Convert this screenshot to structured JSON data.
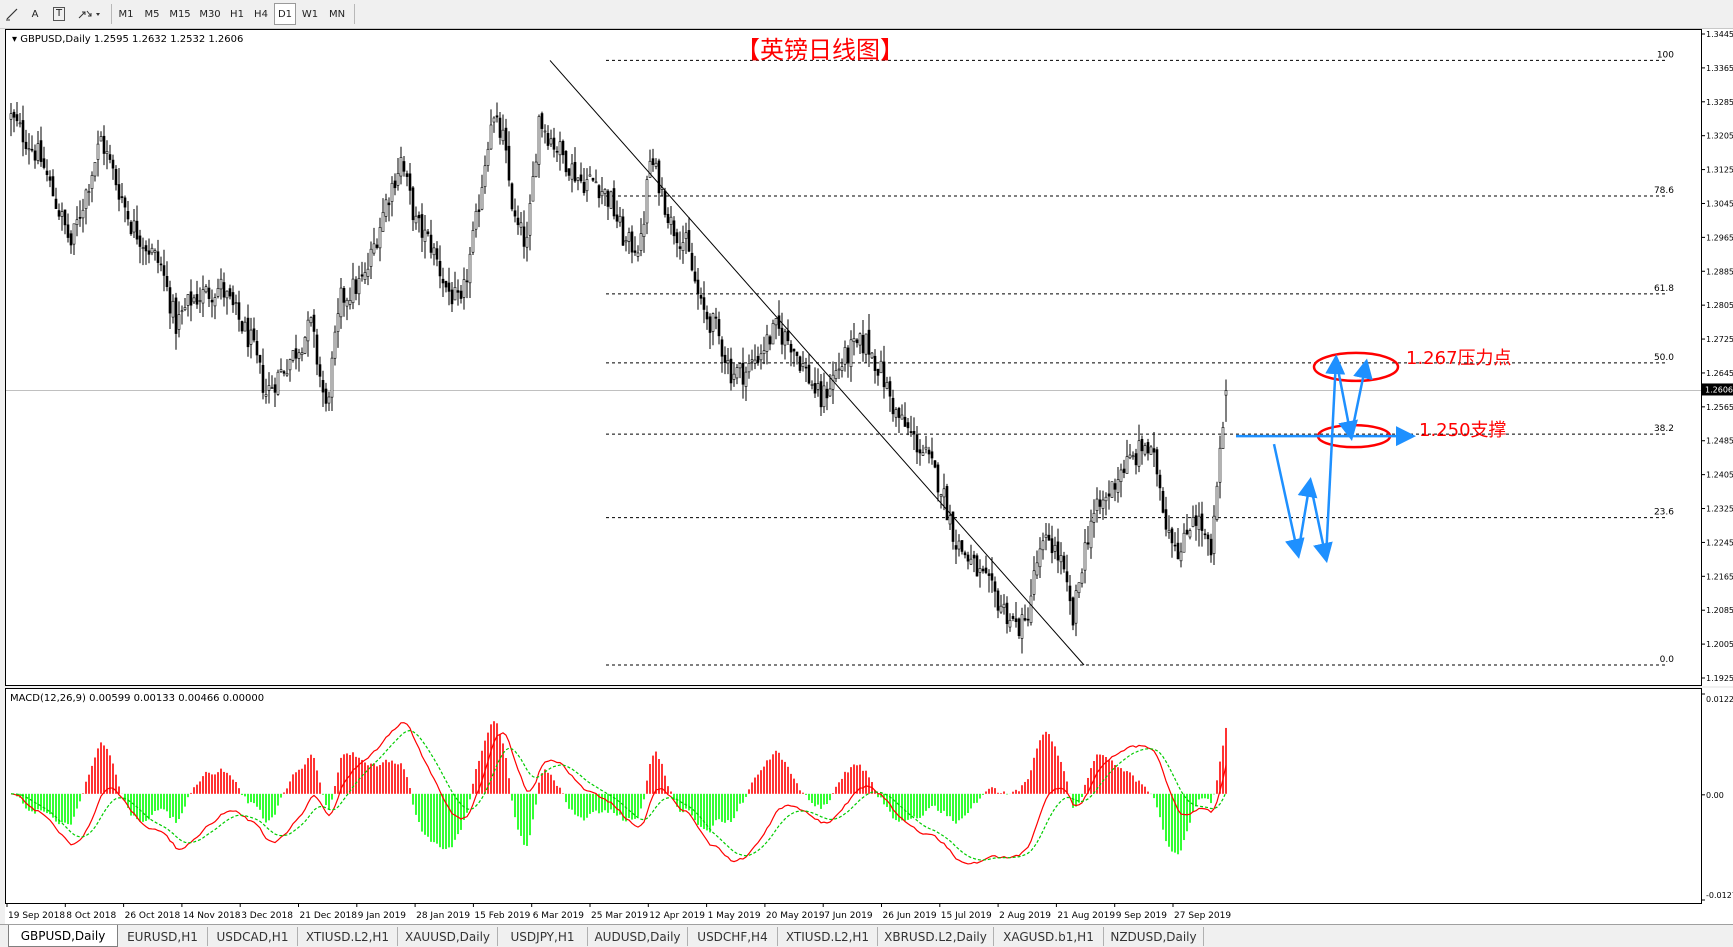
{
  "toolbar": {
    "tools": [
      {
        "name": "line-tool-icon",
        "label": ""
      },
      {
        "name": "text-tool-icon",
        "label": "A"
      },
      {
        "name": "text-label-tool-icon",
        "label": "T"
      },
      {
        "name": "arrows-tool-icon",
        "label": ""
      }
    ],
    "timeframes": [
      "M1",
      "M5",
      "M15",
      "M30",
      "H1",
      "H4",
      "D1",
      "W1",
      "MN"
    ],
    "active_timeframe": "D1"
  },
  "chart": {
    "header": "GBPUSD,Daily  1.2595 1.2632 1.2532 1.2606",
    "annotation_title": "【英镑日线图】",
    "annotation_resistance": "1.267压力点",
    "annotation_support": "1.250支撑",
    "current_price": "1.2606",
    "fib_levels": [
      {
        "label": "100",
        "price": 1.3385
      },
      {
        "label": "78.6",
        "price": 1.3065
      },
      {
        "label": "61.8",
        "price": 1.2834
      },
      {
        "label": "50.0",
        "price": 1.2671
      },
      {
        "label": "38.2",
        "price": 1.2503
      },
      {
        "label": "23.6",
        "price": 1.2306
      },
      {
        "label": "0.0",
        "price": 1.1958
      }
    ],
    "price_ticks": [
      "1.3445",
      "1.3365",
      "1.3285",
      "1.3205",
      "1.3125",
      "1.3045",
      "1.2965",
      "1.2885",
      "1.2805",
      "1.2725",
      "1.2645",
      "1.2565",
      "1.2485",
      "1.2405",
      "1.2325",
      "1.2245",
      "1.2165",
      "1.2085",
      "1.2005",
      "1.1925"
    ],
    "colors": {
      "bull": "#ffffff",
      "bear": "#000000",
      "annotation_red": "#ff0000",
      "annotation_blue": "#1e90ff",
      "grid": "#000000"
    }
  },
  "macd": {
    "header": "MACD(12,26,9) 0.00599 0.00133 0.00466 0.00000",
    "ticks": [
      "0.01225",
      "0.00",
      "-0.01278"
    ],
    "colors": {
      "positive": "#ff0000",
      "negative": "#00ff00",
      "main": "#ff0000",
      "signal": "#00cc00"
    }
  },
  "time_axis": [
    "19 Sep 2018",
    "8 Oct 2018",
    "26 Oct 2018",
    "14 Nov 2018",
    "3 Dec 2018",
    "21 Dec 2018",
    "9 Jan 2019",
    "28 Jan 2019",
    "15 Feb 2019",
    "6 Mar 2019",
    "25 Mar 2019",
    "12 Apr 2019",
    "1 May 2019",
    "20 May 2019",
    "7 Jun 2019",
    "26 Jun 2019",
    "15 Jul 2019",
    "2 Aug 2019",
    "21 Aug 2019",
    "9 Sep 2019",
    "27 Sep 2019"
  ],
  "tabs": [
    "GBPUSD,Daily",
    "EURUSD,H1",
    "USDCAD,H1",
    "XTIUSD.L2,H1",
    "XAUUSD,Daily",
    "USDJPY,H1",
    "AUDUSD,Daily",
    "USDCHF,H4",
    "XTIUSD.L2,H1",
    "XBRUSD.L2,Daily",
    "XAGUSD.b1,H1",
    "NZDUSD,Daily"
  ],
  "active_tab": "GBPUSD,Daily",
  "chart_data": {
    "type": "candlestick",
    "symbol": "GBPUSD",
    "timeframe": "Daily",
    "ohlc_last": {
      "open": 1.2595,
      "high": 1.2632,
      "low": 1.2532,
      "close": 1.2606
    },
    "ylim": [
      1.1925,
      1.3445
    ],
    "close_path": [
      [
        0,
        1.325
      ],
      [
        10,
        1.315
      ],
      [
        20,
        1.295
      ],
      [
        30,
        1.32
      ],
      [
        40,
        1.3
      ],
      [
        50,
        1.29
      ],
      [
        55,
        1.276
      ],
      [
        60,
        1.282
      ],
      [
        70,
        1.285
      ],
      [
        80,
        1.272
      ],
      [
        85,
        1.26
      ],
      [
        95,
        1.27
      ],
      [
        100,
        1.276
      ],
      [
        105,
        1.256
      ],
      [
        110,
        1.282
      ],
      [
        118,
        1.287
      ],
      [
        125,
        1.305
      ],
      [
        130,
        1.315
      ],
      [
        135,
        1.3
      ],
      [
        140,
        1.295
      ],
      [
        145,
        1.285
      ],
      [
        150,
        1.28
      ],
      [
        155,
        1.3
      ],
      [
        160,
        1.325
      ],
      [
        164,
        1.32
      ],
      [
        168,
        1.3
      ],
      [
        172,
        1.295
      ],
      [
        176,
        1.325
      ],
      [
        180,
        1.32
      ],
      [
        185,
        1.315
      ],
      [
        190,
        1.31
      ],
      [
        195,
        1.31
      ],
      [
        200,
        1.305
      ],
      [
        205,
        1.295
      ],
      [
        210,
        1.295
      ],
      [
        213,
        1.315
      ],
      [
        216,
        1.31
      ],
      [
        220,
        1.3
      ],
      [
        225,
        1.295
      ],
      [
        230,
        1.28
      ],
      [
        235,
        1.275
      ],
      [
        240,
        1.265
      ],
      [
        245,
        1.265
      ],
      [
        250,
        1.27
      ],
      [
        255,
        1.275
      ],
      [
        260,
        1.272
      ],
      [
        265,
        1.265
      ],
      [
        270,
        1.258
      ],
      [
        275,
        1.265
      ],
      [
        280,
        1.27
      ],
      [
        285,
        1.272
      ],
      [
        290,
        1.265
      ],
      [
        295,
        1.255
      ],
      [
        300,
        1.25
      ],
      [
        305,
        1.245
      ],
      [
        310,
        1.238
      ],
      [
        315,
        1.225
      ],
      [
        320,
        1.22
      ],
      [
        325,
        1.215
      ],
      [
        330,
        1.21
      ],
      [
        335,
        1.205
      ],
      [
        338,
        1.205
      ],
      [
        342,
        1.22
      ],
      [
        346,
        1.226
      ],
      [
        350,
        1.22
      ],
      [
        354,
        1.206
      ],
      [
        357,
        1.22
      ],
      [
        360,
        1.23
      ],
      [
        365,
        1.235
      ],
      [
        370,
        1.242
      ],
      [
        375,
        1.245
      ],
      [
        378,
        1.248
      ],
      [
        382,
        1.242
      ],
      [
        385,
        1.23
      ],
      [
        390,
        1.222
      ],
      [
        394,
        1.232
      ],
      [
        397,
        1.228
      ],
      [
        400,
        1.221
      ],
      [
        403,
        1.245
      ],
      [
        405,
        1.2606
      ]
    ],
    "fibonacci": {
      "high": 1.3385,
      "low": 1.1958,
      "levels": {
        "100": 1.3385,
        "78.6": 1.3065,
        "61.8": 1.2834,
        "50.0": 1.2671,
        "38.2": 1.2503,
        "23.6": 1.2306,
        "0.0": 1.1958
      }
    },
    "trendline": {
      "from": [
        180,
        1.3385
      ],
      "to": [
        358,
        1.1958
      ]
    },
    "macd_params": [
      12,
      26,
      9
    ],
    "macd_values": {
      "macd": 0.00599,
      "signal": 0.00133,
      "histogram": 0.00466
    },
    "macd_ylim": [
      -0.01278,
      0.01225
    ]
  }
}
